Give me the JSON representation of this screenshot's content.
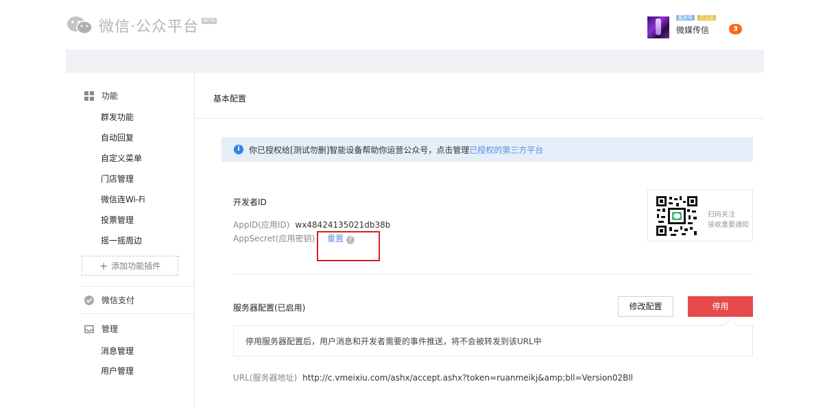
{
  "header": {
    "brand_title": "微信·公众平台",
    "beta_badge": "BETA",
    "account_badges": [
      "服务号",
      "已认证"
    ],
    "account_name": "微媒传信",
    "notice_count": "3"
  },
  "sidebar": {
    "function_group": {
      "title": "功能",
      "items": [
        "群发功能",
        "自动回复",
        "自定义菜单",
        "门店管理",
        "微信连Wi-Fi",
        "投票管理",
        "摇一摇周边"
      ]
    },
    "add_plugin": "添加功能插件",
    "pay_group": {
      "title": "微信支付"
    },
    "manage_group": {
      "title": "管理",
      "items": [
        "消息管理",
        "用户管理"
      ]
    }
  },
  "main": {
    "page_title": "基本配置",
    "info": {
      "text": "你已授权给[测试勿删]智能设备帮助你运营公众号，点击管理",
      "link": "已授权的第三方平台"
    },
    "developer": {
      "title": "开发者ID",
      "appid_label": "AppID(应用ID)",
      "appid_value": "wx48424135021db38b",
      "secret_label": "AppSecret(应用密钥)",
      "reset_link": "重置",
      "help_glyph": "?"
    },
    "qr": {
      "line1": "扫码关注",
      "line2": "接收重要通知"
    },
    "server": {
      "title": "服务器配置(已启用)",
      "modify_button": "修改配置",
      "disable_button": "停用",
      "tooltip": "停用服务器配置后，用户消息和开发者需要的事件推送，将不会被转发到该URL中",
      "url_label": "URL(服务器地址)",
      "url_value": "http://c.vmeixiu.com/ashx/accept.ashx?token=ruanmeikj&amp;bll=Version02Bll"
    }
  },
  "colors": {
    "accent_link": "#5691e8",
    "danger_button": "#e64a4a",
    "info_bg": "#e5eef9",
    "highlight_border": "#d52020"
  }
}
